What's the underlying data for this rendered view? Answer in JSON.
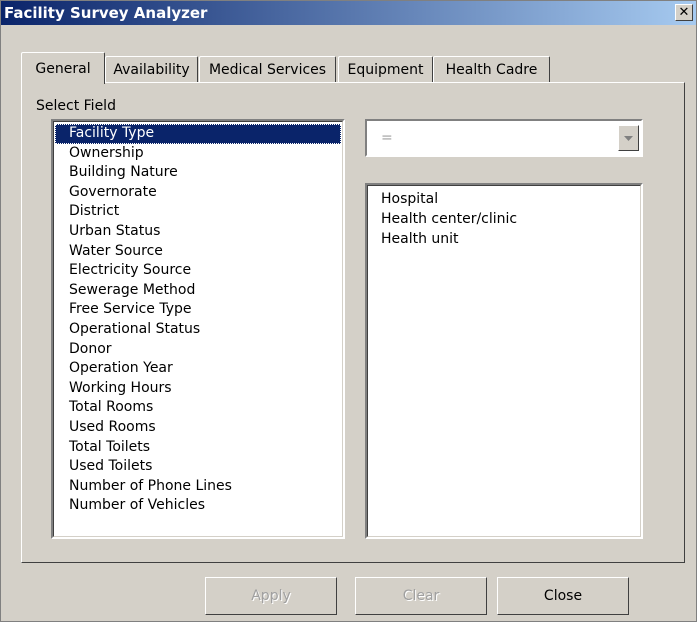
{
  "window": {
    "title": "Facility Survey Analyzer",
    "close_glyph": "✕"
  },
  "tabs": [
    {
      "label": "General"
    },
    {
      "label": "Availability"
    },
    {
      "label": "Medical Services"
    },
    {
      "label": "Equipment"
    },
    {
      "label": "Health Cadre"
    }
  ],
  "select_field": {
    "label": "Select Field",
    "items": [
      "Facility Type",
      "Ownership",
      "Building Nature",
      "Governorate",
      "District",
      "Urban Status",
      "Water Source",
      "Electricity Source",
      "Sewerage Method",
      "Free Service Type",
      "Operational Status",
      "Donor",
      "Operation Year",
      "Working Hours",
      "Total Rooms",
      "Used Rooms",
      "Total Toilets",
      "Used Toilets",
      "Number of Phone Lines",
      "Number of Vehicles"
    ],
    "selected": "Facility Type"
  },
  "operator": {
    "value": "="
  },
  "values_list": {
    "items": [
      "Hospital",
      "Health center/clinic",
      "Health unit"
    ]
  },
  "buttons": {
    "apply": "Apply",
    "clear": "Clear",
    "close": "Close"
  }
}
